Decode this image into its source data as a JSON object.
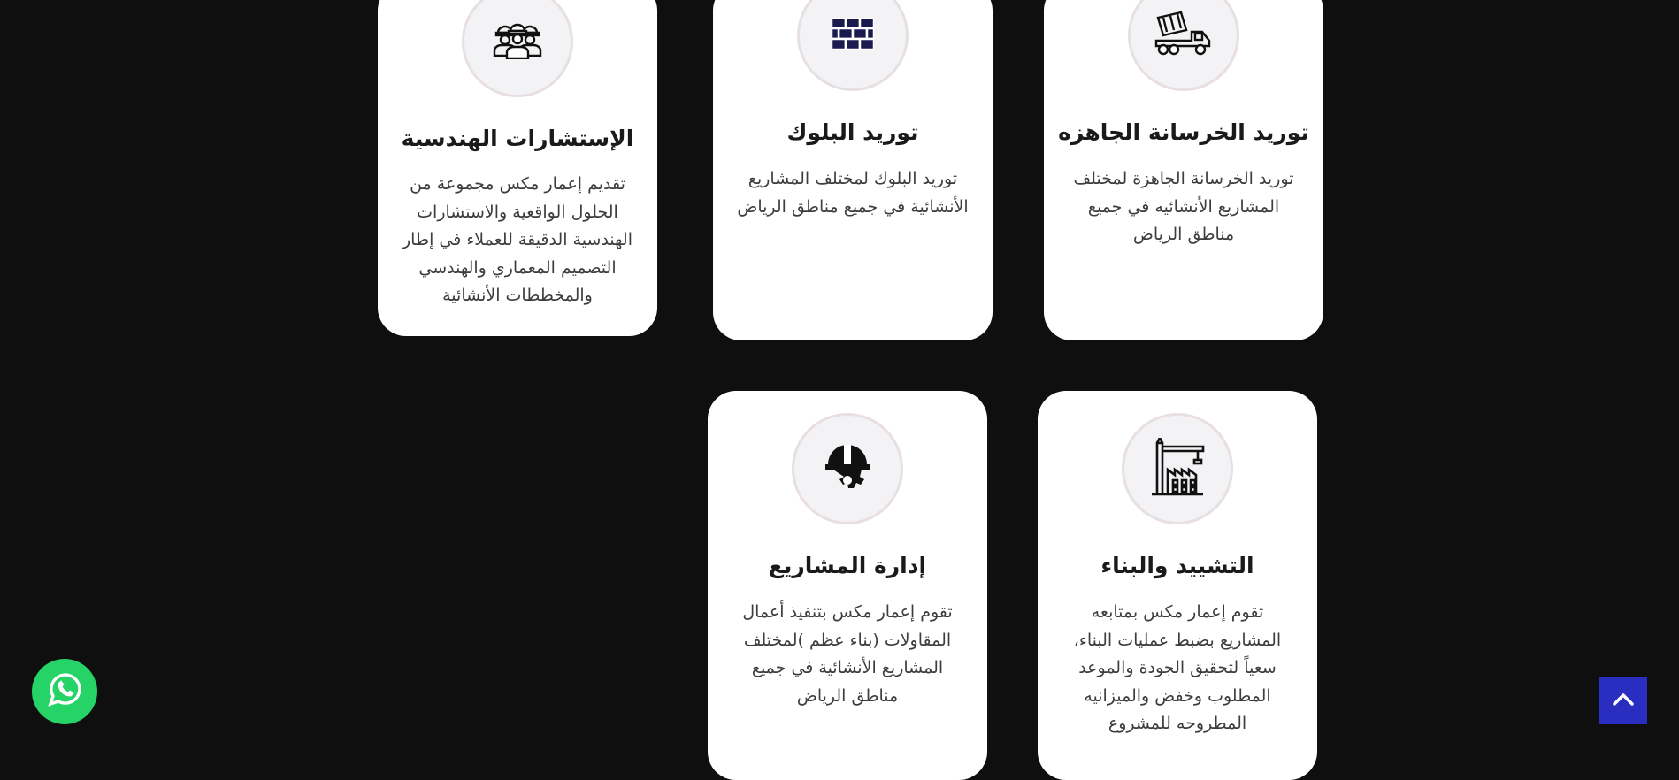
{
  "services": [
    {
      "title": "الإستشارات الهندسية",
      "description": "تقديم إعمار مكس مجموعة من الحلول الواقعية والاستشارات الهندسية الدقيقة للعملاء في إطار التصميم المعماري والهندسي والمخططات الأنشائية",
      "icon": "engineers-icon"
    },
    {
      "title": "توريد البلوك",
      "description": "توريد البلوك لمختلف المشاريع الأنشائية في جميع مناطق الرياض",
      "icon": "bricks-icon"
    },
    {
      "title": "توريد الخرسانة الجاهزه",
      "description": "توريد الخرسانة الجاهزة لمختلف المشاريع الأنشائيه في جميع مناطق الرياض",
      "icon": "concrete-mixer-truck-icon"
    },
    {
      "title": "إدارة المشاريع",
      "description": "تقوم إعمار مكس بتنفيذ أعمال المقاولات (بناء عظم )لمختلف المشاريع الأنشائية في جميع مناطق الرياض",
      "icon": "hardhat-gear-icon"
    },
    {
      "title": "التشييد والبناء",
      "description": "تقوم إعمار مكس بمتابعه المشاريع بضبط عمليات البناء، سعياً لتحقيق الجودة والموعد المطلوب وخفض والميزانيه المطروحه للمشروع",
      "icon": "crane-building-icon"
    }
  ],
  "floating": {
    "whatsapp_icon": "whatsapp-icon",
    "whatsapp_color": "#25d366",
    "scroll_top_icon": "chevron-up-icon",
    "scroll_top_color": "#2a2ec0"
  },
  "colors": {
    "background": "#0f0f0f",
    "card": "#ffffff",
    "icon_dark": "#1a1a4e"
  }
}
